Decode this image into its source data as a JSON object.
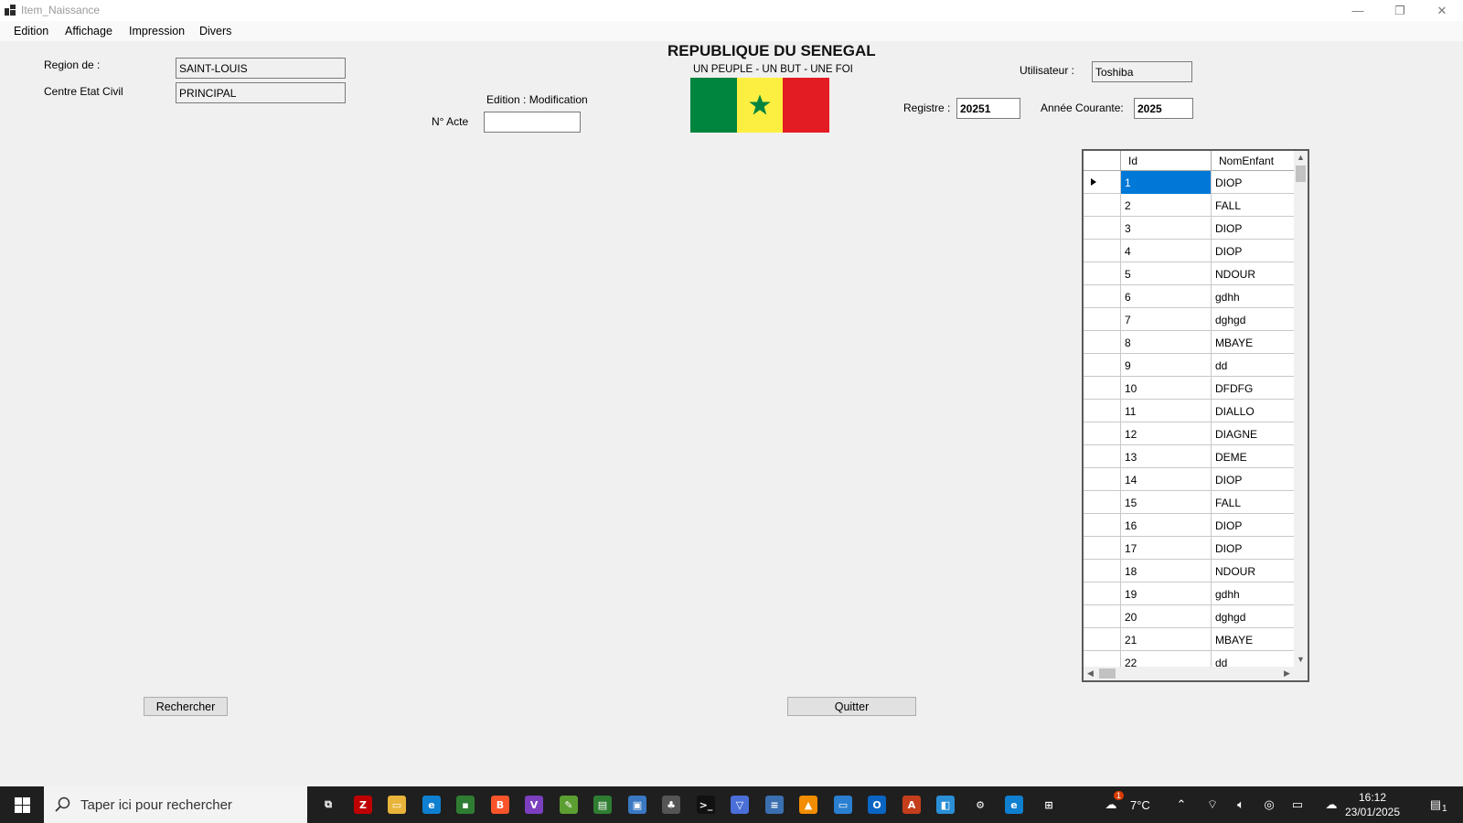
{
  "window": {
    "title": "Item_Naissance",
    "minimize_label": "—",
    "restore_label": "❐",
    "close_label": "✕"
  },
  "menu": {
    "items": [
      "Edition",
      "Affichage",
      "Impression",
      "Divers"
    ]
  },
  "form": {
    "region_label": "Region de :",
    "region_value": "SAINT-LOUIS",
    "centre_label": "Centre Etat Civil",
    "centre_value": "PRINCIPAL",
    "edition_label": "Edition : Modification",
    "nacte_label": "N° Acte",
    "nacte_value": "",
    "utilisateur_label": "Utilisateur :",
    "utilisateur_value": "Toshiba",
    "registre_label": "Registre :",
    "registre_value": "20251",
    "annee_label": "Année  Courante:",
    "annee_value": "2025"
  },
  "header": {
    "title": "REPUBLIQUE DU SENEGAL",
    "motto": "UN PEUPLE - UN BUT - UNE FOI",
    "flag_colors": [
      "#00853f",
      "#fdef42",
      "#e31b23"
    ],
    "star_color": "#00853f"
  },
  "grid": {
    "columns": [
      "Id",
      "NomEnfant"
    ],
    "selected_row": 0,
    "rows": [
      {
        "id": "1",
        "nom": "DIOP"
      },
      {
        "id": "2",
        "nom": "FALL"
      },
      {
        "id": "3",
        "nom": "DIOP"
      },
      {
        "id": "4",
        "nom": "DIOP"
      },
      {
        "id": "5",
        "nom": "NDOUR"
      },
      {
        "id": "6",
        "nom": "gdhh"
      },
      {
        "id": "7",
        "nom": "dghgd"
      },
      {
        "id": "8",
        "nom": "MBAYE"
      },
      {
        "id": "9",
        "nom": "dd"
      },
      {
        "id": "10",
        "nom": "DFDFG"
      },
      {
        "id": "11",
        "nom": "DIALLO"
      },
      {
        "id": "12",
        "nom": "DIAGNE"
      },
      {
        "id": "13",
        "nom": "DEME"
      },
      {
        "id": "14",
        "nom": "DIOP"
      },
      {
        "id": "15",
        "nom": "FALL"
      },
      {
        "id": "16",
        "nom": "DIOP"
      },
      {
        "id": "17",
        "nom": "DIOP"
      },
      {
        "id": "18",
        "nom": "NDOUR"
      },
      {
        "id": "19",
        "nom": "gdhh"
      },
      {
        "id": "20",
        "nom": "dghgd"
      },
      {
        "id": "21",
        "nom": "MBAYE"
      },
      {
        "id": "22",
        "nom": "dd"
      }
    ]
  },
  "buttons": {
    "rechercher": "Rechercher",
    "quitter": "Quitter"
  },
  "taskbar": {
    "search_placeholder": "Taper ici pour rechercher",
    "weather": "7°C",
    "weather_badge": "1",
    "time": "16:12",
    "date": "23/01/2025",
    "notification_count": "1",
    "apps": [
      {
        "name": "task-view",
        "color": "#1f1f1f",
        "glyph": "⧉"
      },
      {
        "name": "filezilla",
        "color": "#bf0000",
        "glyph": "Z"
      },
      {
        "name": "file-explorer",
        "color": "#e8b43a",
        "glyph": "▭"
      },
      {
        "name": "edge",
        "color": "#0f7fd0",
        "glyph": "e"
      },
      {
        "name": "terminal-app",
        "color": "#2e7d32",
        "glyph": "▪"
      },
      {
        "name": "brave",
        "color": "#fb542b",
        "glyph": "B"
      },
      {
        "name": "visual-studio",
        "color": "#7b3fbf",
        "glyph": "V"
      },
      {
        "name": "drawing-app",
        "color": "#5c9e31",
        "glyph": "✎"
      },
      {
        "name": "project-app",
        "color": "#2f7d32",
        "glyph": "▤"
      },
      {
        "name": "remote-app",
        "color": "#3a78c2",
        "glyph": "▣"
      },
      {
        "name": "tree-app",
        "color": "#555555",
        "glyph": "♣"
      },
      {
        "name": "cmd",
        "color": "#111111",
        "glyph": ">_"
      },
      {
        "name": "vpn-app",
        "color": "#4a6fd8",
        "glyph": "▽"
      },
      {
        "name": "news-app",
        "color": "#3a6fb0",
        "glyph": "≡"
      },
      {
        "name": "vlc",
        "color": "#f28c00",
        "glyph": "▲"
      },
      {
        "name": "rdp-app",
        "color": "#2a7fd0",
        "glyph": "▭"
      },
      {
        "name": "outlook",
        "color": "#0a64c2",
        "glyph": "O"
      },
      {
        "name": "access-app",
        "color": "#c43e1c",
        "glyph": "A"
      },
      {
        "name": "notes-app",
        "color": "#2a8fd6",
        "glyph": "◧"
      },
      {
        "name": "settings",
        "color": "#1f1f1f",
        "glyph": "⚙"
      },
      {
        "name": "edge-2",
        "color": "#0f7fd0",
        "glyph": "e"
      },
      {
        "name": "window-app",
        "color": "#1f1f1f",
        "glyph": "⊞"
      }
    ]
  }
}
